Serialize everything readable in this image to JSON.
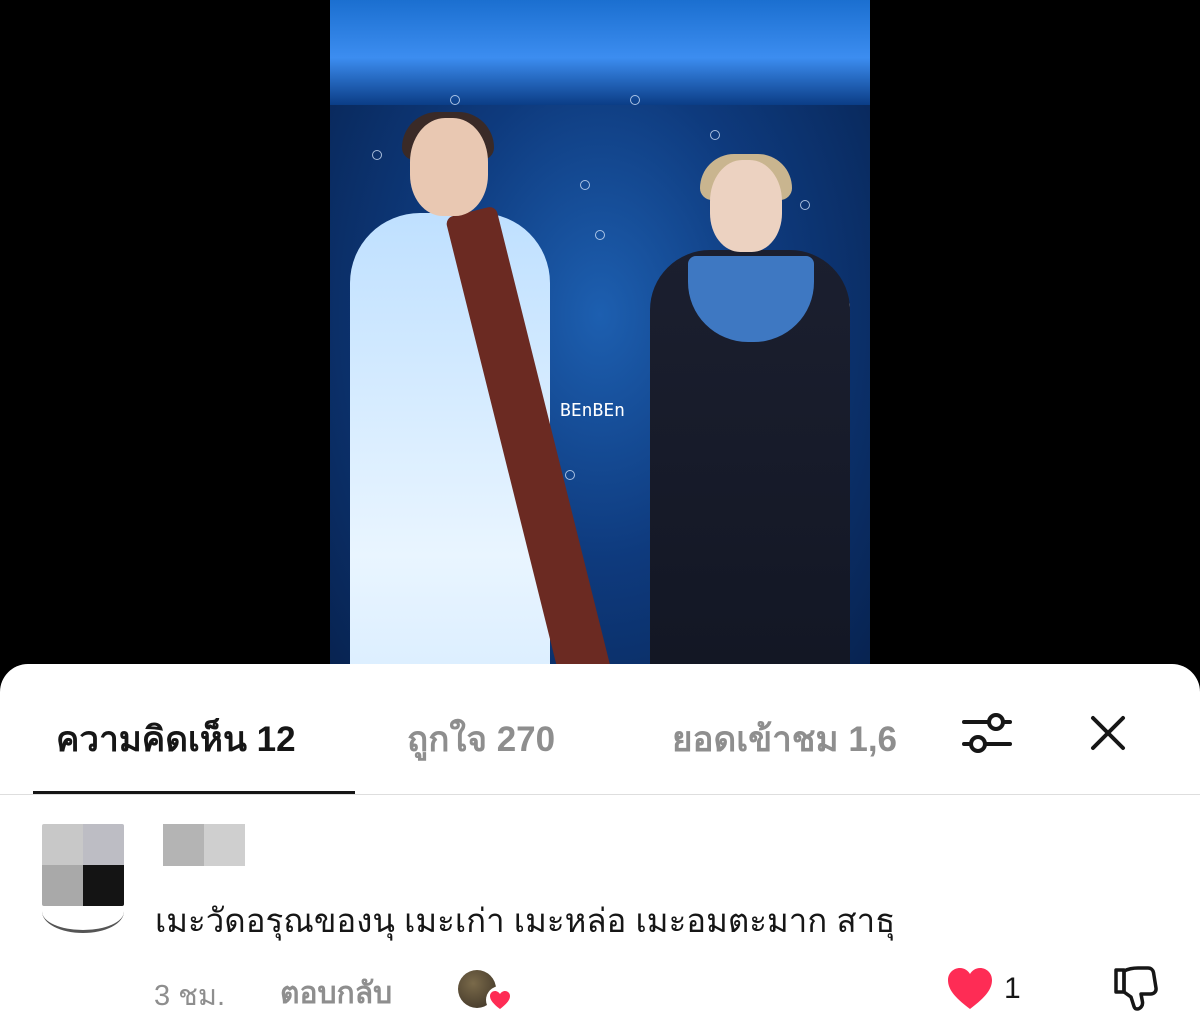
{
  "video": {
    "watermark": "BEnBEn"
  },
  "tabs": {
    "comments": "ความคิดเห็น 12",
    "likes": "ถูกใจ 270",
    "views": "ยอดเข้าชม 1,6"
  },
  "comment": {
    "text": "เมะวัดอรุณของนุ เมะเก่า เมะหล่อ เมะอมตะมาก สาธุ",
    "time": "3 ชม.",
    "reply_label": "ตอบกลับ",
    "like_count": "1",
    "liked": true,
    "liked_by_creator": true
  },
  "colors": {
    "active_tab": "#161616",
    "inactive_tab": "#8e8e8e",
    "heart": "#fe2c55",
    "stage_blue": "#0e3a7d"
  },
  "icons": {
    "filter": "sliders-icon",
    "close": "close-icon",
    "like": "heart-icon",
    "dislike": "thumbs-down-icon"
  }
}
